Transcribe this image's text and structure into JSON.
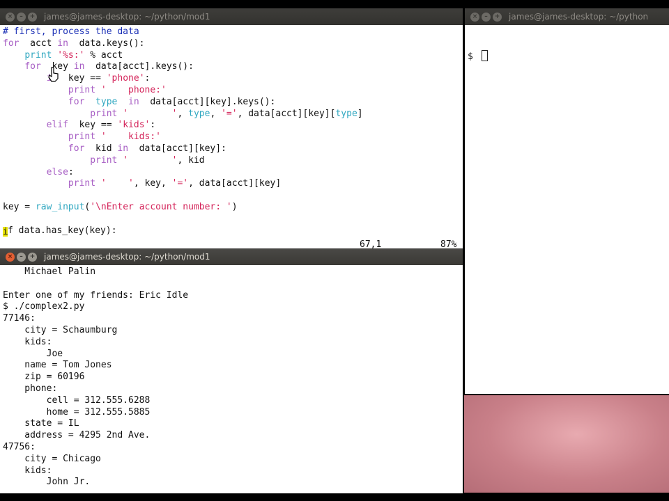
{
  "windows": {
    "editor": {
      "title": "james@james-desktop: ~/python/mod1",
      "status_pos": "67,1",
      "status_pct": "87%",
      "code_lines": [
        [
          [
            "cmt",
            "# first, process the data"
          ]
        ],
        [
          [
            "kw",
            "for"
          ],
          [
            "",
            "  acct "
          ],
          [
            "kw",
            "in"
          ],
          [
            "",
            "  data.keys():"
          ]
        ],
        [
          [
            "",
            "    "
          ],
          [
            "fn",
            "print"
          ],
          [
            "str",
            " '%s:'"
          ],
          [
            "",
            " % acct"
          ]
        ],
        [
          [
            "",
            "    "
          ],
          [
            "kw",
            "for"
          ],
          [
            "",
            "  key "
          ],
          [
            "kw",
            "in"
          ],
          [
            "",
            "  data[acct].keys():"
          ]
        ],
        [
          [
            "",
            "        "
          ],
          [
            "kw",
            "if"
          ],
          [
            "",
            "  key == "
          ],
          [
            "str",
            "'phone'"
          ],
          [
            "",
            ":"
          ]
        ],
        [
          [
            "",
            "            "
          ],
          [
            "kw",
            "print"
          ],
          [
            "str",
            " '    phone:'"
          ]
        ],
        [
          [
            "",
            "            "
          ],
          [
            "kw",
            "for"
          ],
          [
            "",
            "  "
          ],
          [
            "typ",
            "type"
          ],
          [
            "",
            "  "
          ],
          [
            "kw",
            "in"
          ],
          [
            "",
            "  data[acct][key].keys():"
          ]
        ],
        [
          [
            "",
            "                "
          ],
          [
            "kw",
            "print"
          ],
          [
            "str",
            " '        '"
          ],
          [
            "",
            ", "
          ],
          [
            "typ",
            "type"
          ],
          [
            "",
            ", "
          ],
          [
            "str",
            "'='"
          ],
          [
            "",
            ", data[acct][key]["
          ],
          [
            "typ",
            "type"
          ],
          [
            "",
            "]"
          ]
        ],
        [
          [
            "",
            "        "
          ],
          [
            "kw",
            "elif"
          ],
          [
            "",
            "  key == "
          ],
          [
            "str",
            "'kids'"
          ],
          [
            "",
            ":"
          ]
        ],
        [
          [
            "",
            "            "
          ],
          [
            "kw",
            "print"
          ],
          [
            "str",
            " '    kids:'"
          ]
        ],
        [
          [
            "",
            "            "
          ],
          [
            "kw",
            "for"
          ],
          [
            "",
            "  kid "
          ],
          [
            "kw",
            "in"
          ],
          [
            "",
            "  data[acct][key]:"
          ]
        ],
        [
          [
            "",
            "                "
          ],
          [
            "kw",
            "print"
          ],
          [
            "str",
            " '        '"
          ],
          [
            "",
            ", kid"
          ]
        ],
        [
          [
            "",
            "        "
          ],
          [
            "kw",
            "else"
          ],
          [
            "",
            ":"
          ]
        ],
        [
          [
            "",
            "            "
          ],
          [
            "kw",
            "print"
          ],
          [
            "str",
            " '    '"
          ],
          [
            "",
            ", key, "
          ],
          [
            "str",
            "'='"
          ],
          [
            "",
            ", data[acct][key]"
          ]
        ],
        [
          [
            "",
            ""
          ]
        ],
        [
          [
            "",
            "key = "
          ],
          [
            "fn",
            "raw_input"
          ],
          [
            "",
            "("
          ],
          [
            "str",
            "'\\nEnter account number: '"
          ],
          [
            "",
            ")"
          ]
        ],
        [
          [
            "",
            ""
          ]
        ],
        [
          [
            "cur",
            "i"
          ],
          [
            "",
            "f data.has_key(key):"
          ]
        ]
      ]
    },
    "output": {
      "title": "james@james-desktop: ~/python/mod1",
      "lines": [
        "    Michael Palin",
        "",
        "Enter one of my friends: Eric Idle",
        "$ ./complex2.py",
        "77146:",
        "    city = Schaumburg",
        "    kids:",
        "        Joe",
        "    name = Tom Jones",
        "    zip = 60196",
        "    phone:",
        "        cell = 312.555.6288",
        "        home = 312.555.5885",
        "    state = IL",
        "    address = 4295 2nd Ave.",
        "47756:",
        "    city = Chicago",
        "    kids:",
        "        John Jr."
      ]
    },
    "shell": {
      "title": "james@james-desktop: ~/python",
      "prompt": "$ "
    }
  },
  "window_buttons": {
    "close": "×",
    "minimize": "–",
    "maximize": "+"
  }
}
